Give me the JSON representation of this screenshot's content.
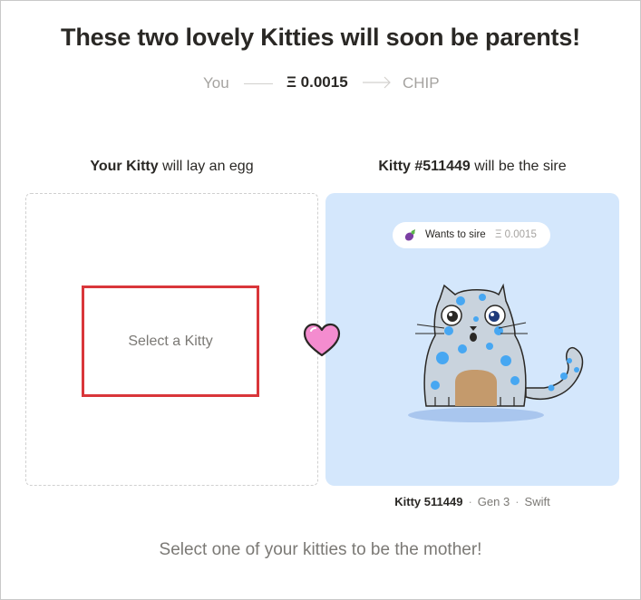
{
  "title": "These two lovely Kitties will soon be parents!",
  "flow": {
    "from": "You",
    "amount": "Ξ 0.0015",
    "to": "CHIP"
  },
  "left": {
    "heading_bold": "Your Kitty",
    "heading_rest": " will lay an egg",
    "select_button": "Select a Kitty"
  },
  "right": {
    "heading_bold": "Kitty #511449",
    "heading_rest": " will be the sire",
    "pill_label": "Wants to sire",
    "pill_price": "Ξ 0.0015",
    "caption_name": "Kitty 511449",
    "caption_gen": "Gen 3",
    "caption_speed": "Swift"
  },
  "bottom_message": "Select one of your kitties to be the mother!",
  "colors": {
    "accent_red": "#d9363a",
    "panel_blue": "#d4e7fc",
    "heart_pink": "#f48ccf"
  }
}
